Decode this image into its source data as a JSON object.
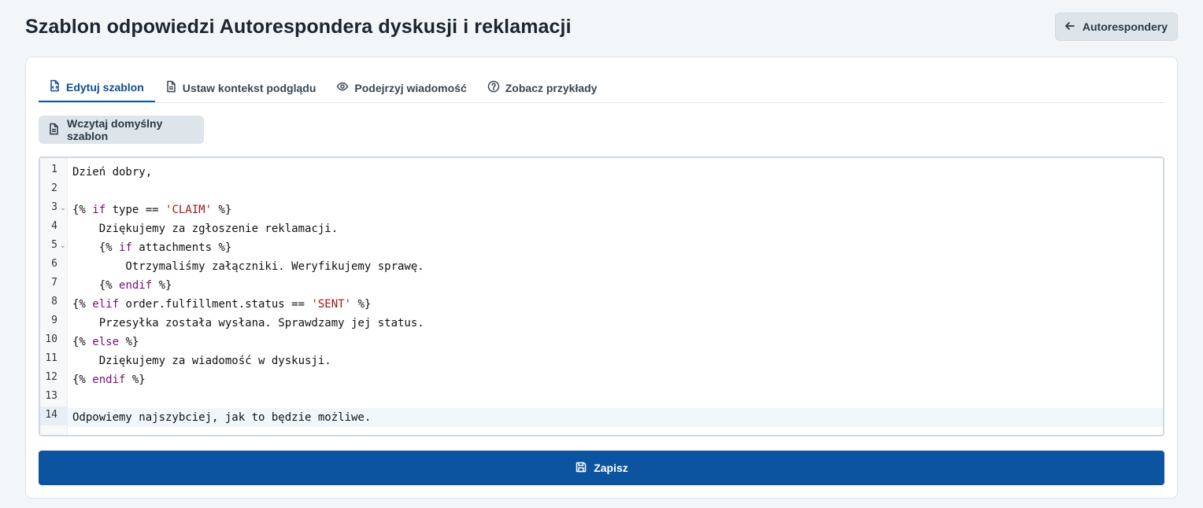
{
  "page": {
    "title": "Szablon odpowiedzi Autorespondera dyskusji i reklamacji",
    "back_button_label": "Autorespondery",
    "back_button_icon": "arrow-left-icon"
  },
  "tabs": [
    {
      "label": "Edytuj szablon",
      "icon": "code-file-icon",
      "active": true
    },
    {
      "label": "Ustaw kontekst podglądu",
      "icon": "document-icon",
      "active": false
    },
    {
      "label": "Podejrzyj wiadomość",
      "icon": "eye-icon",
      "active": false
    },
    {
      "label": "Zobacz przykłady",
      "icon": "help-circle-icon",
      "active": false
    }
  ],
  "load_default_button": {
    "label": "Wczytaj domyślny szablon",
    "icon": "document-icon"
  },
  "editor": {
    "active_line": 14,
    "lines": [
      {
        "num": "1",
        "text": "Dzień dobry,",
        "fold": false
      },
      {
        "num": "2",
        "text": "",
        "fold": false
      },
      {
        "num": "3",
        "text": "{% if type == 'CLAIM' %}",
        "fold": true
      },
      {
        "num": "4",
        "text": "    Dziękujemy za zgłoszenie reklamacji.",
        "fold": false
      },
      {
        "num": "5",
        "text": "    {% if attachments %}",
        "fold": true
      },
      {
        "num": "6",
        "text": "        Otrzymaliśmy załączniki. Weryfikujemy sprawę.",
        "fold": false
      },
      {
        "num": "7",
        "text": "    {% endif %}",
        "fold": false
      },
      {
        "num": "8",
        "text": "{% elif order.fulfillment.status == 'SENT' %}",
        "fold": false
      },
      {
        "num": "9",
        "text": "    Przesyłka została wysłana. Sprawdzamy jej status.",
        "fold": false
      },
      {
        "num": "10",
        "text": "{% else %}",
        "fold": false
      },
      {
        "num": "11",
        "text": "    Dziękujemy za wiadomość w dyskusji.",
        "fold": false
      },
      {
        "num": "12",
        "text": "{% endif %}",
        "fold": false
      },
      {
        "num": "13",
        "text": "",
        "fold": false
      },
      {
        "num": "14",
        "text": "Odpowiemy najszybciej, jak to będzie możliwe.",
        "fold": false
      }
    ]
  },
  "save_button": {
    "label": "Zapisz",
    "icon": "save-icon"
  },
  "colors": {
    "accent": "#0c54a0",
    "background": "#f3f6f9",
    "keyword": "#7a0c7a",
    "string": "#a31515"
  }
}
